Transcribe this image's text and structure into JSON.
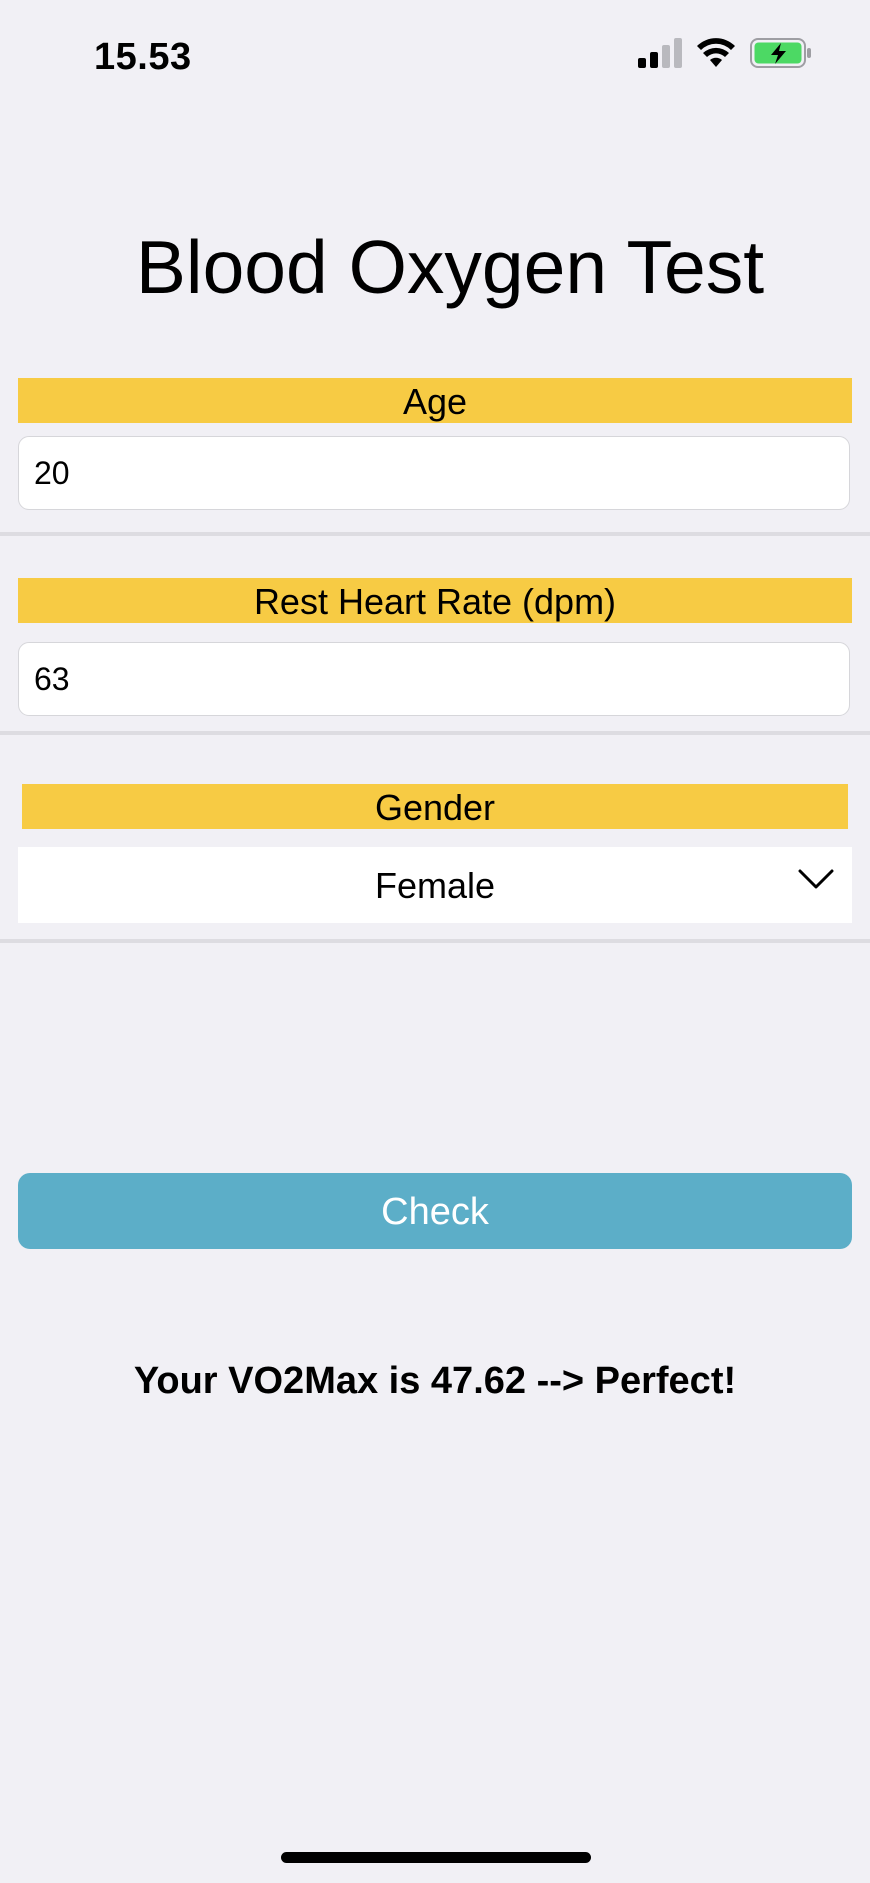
{
  "status_bar": {
    "time": "15.53",
    "icons": [
      "cellular-signal-icon",
      "wifi-icon",
      "battery-charging-icon"
    ]
  },
  "title": "Blood Oxygen Test",
  "form": {
    "age": {
      "label": "Age",
      "value": "20"
    },
    "rest_heart_rate": {
      "label": "Rest Heart Rate (dpm)",
      "value": "63"
    },
    "gender": {
      "label": "Gender",
      "selected": "Female"
    }
  },
  "check_button": {
    "label": "Check"
  },
  "result": {
    "text": "Your VO2Max is 47.62 --> Perfect!"
  },
  "colors": {
    "background": "#F1F0F5",
    "label_bar": "#F7CB44",
    "button": "#5CAEC8",
    "battery": "#4CD964"
  }
}
